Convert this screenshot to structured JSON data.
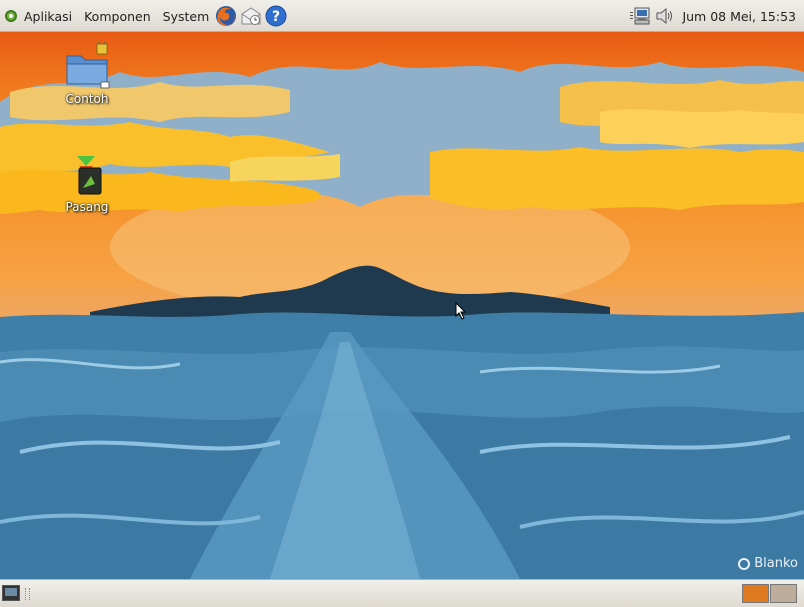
{
  "top_panel": {
    "menus": [
      "Aplikasi",
      "Komponen",
      "System"
    ],
    "launchers": [
      "firefox-icon",
      "mail-icon",
      "help-icon"
    ],
    "clock": "Jum 08 Mei, 15:53",
    "tray_icons": [
      "network-icon",
      "volume-icon"
    ]
  },
  "desktop": {
    "icons": [
      {
        "label": "Contoh",
        "icon": "folder-icon"
      },
      {
        "label": "Pasang",
        "icon": "installer-icon"
      }
    ],
    "brand": "Blanko"
  },
  "bottom_panel": {
    "workspaces": [
      "#e07a1e",
      "#bcae9a"
    ]
  }
}
